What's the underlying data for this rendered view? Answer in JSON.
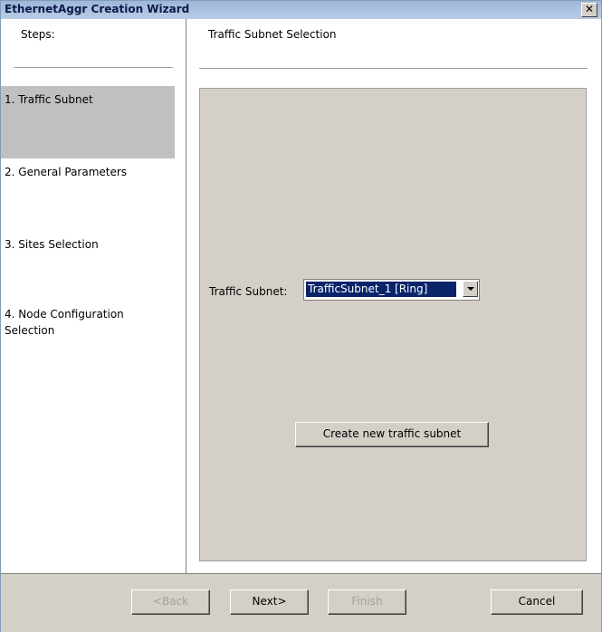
{
  "window": {
    "title": "EthernetAggr Creation Wizard",
    "close_glyph": "✕"
  },
  "steps": {
    "header": "Steps:",
    "items": [
      {
        "label": "1. Traffic Subnet"
      },
      {
        "label": "2. General Parameters"
      },
      {
        "label": "3. Sites Selection"
      },
      {
        "label": "4. Node Configuration Selection"
      }
    ]
  },
  "panel": {
    "title": "Traffic Subnet Selection",
    "field_label": "Traffic Subnet:",
    "field_value": "TrafficSubnet_1 [Ring]",
    "create_button": "Create new traffic subnet"
  },
  "footer": {
    "back": "<Back",
    "next": "Next>",
    "finish": "Finish",
    "cancel": "Cancel"
  }
}
